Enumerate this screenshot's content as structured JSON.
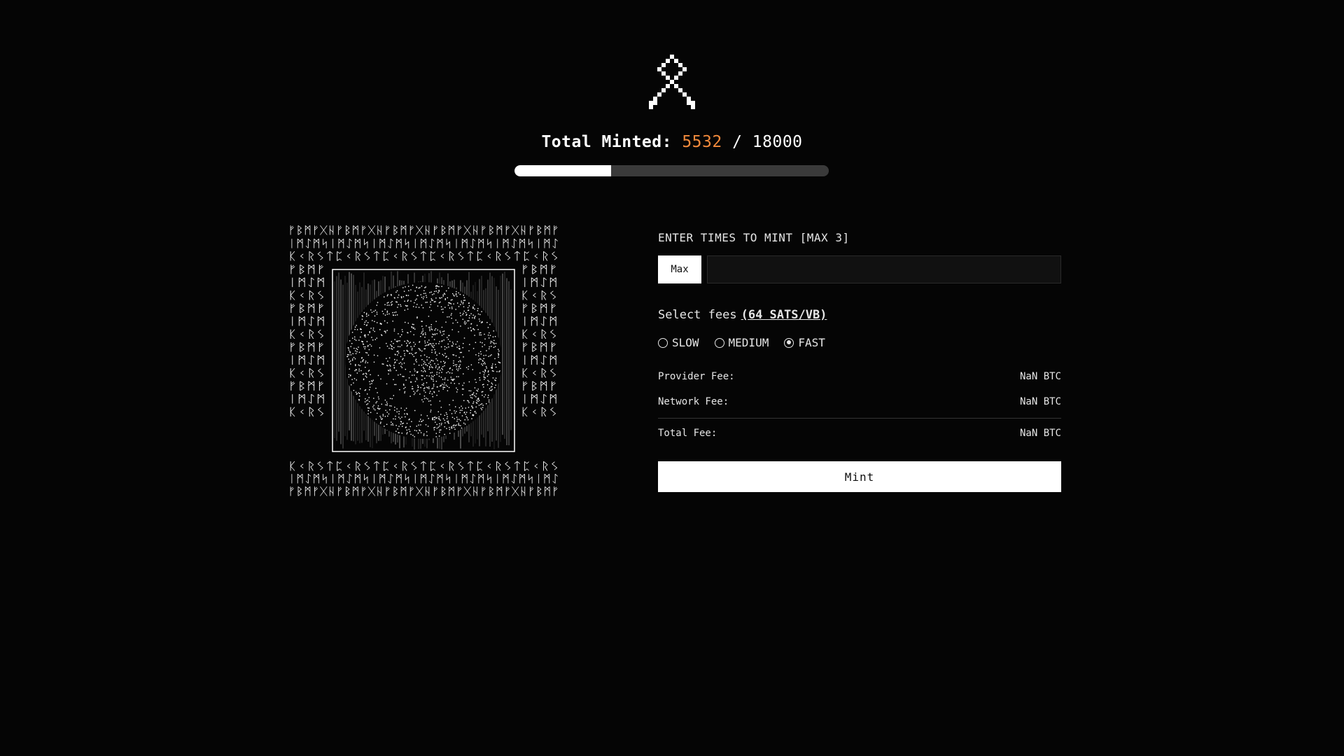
{
  "header": {
    "logo_icon": "othala-rune-icon",
    "minted_label": "Total Minted:",
    "minted_count": "5532",
    "minted_separator": "/",
    "minted_total": "18000",
    "progress_fraction": 0.307,
    "accent_color": "#f28a3c"
  },
  "artwork": {
    "icon": "rune-sphere-artwork",
    "rune_rows": [
      "ᚠᛒᛗᚠᚷᚺᚠᛒᛗᚠᚷᚺᚠᛒᛗᚠᚷᚺᚠᛒᛗᚠᚷᚺᚠᛒᛗᚠᚷᚺᚠᛒᛗᚠ",
      "ᛁᛗᛇᛗᛋᛁᛗᛇᛗᛋᛁᛗᛇᛗᛋᛁᛗᛇᛗᛋᛁᛗᛇᛗᛋᛁᛗᛇᛗᛋᛁᛗᛇ",
      "ᛕᚲᚱᛊᛏᛈᚲᚱᛊᛏᛈᚲᚱᛊᛏᛈᚲᚱᛊᛏᛈᚲᚱᛊᛏᛈᚲᚱᛊ"
    ]
  },
  "form": {
    "times_label": "ENTER TIMES TO MINT [MAX 3]",
    "max_button": "Max",
    "times_value": "",
    "fees_label": "Select fees",
    "fees_rate": "(64 SATS/VB)",
    "fee_options": [
      "SLOW",
      "MEDIUM",
      "FAST"
    ],
    "selected_fee": "FAST",
    "provider_fee_label": "Provider Fee:",
    "provider_fee_value": "NaN BTC",
    "network_fee_label": "Network Fee:",
    "network_fee_value": "NaN BTC",
    "total_fee_label": "Total Fee:",
    "total_fee_value": "NaN BTC",
    "mint_button": "Mint"
  }
}
